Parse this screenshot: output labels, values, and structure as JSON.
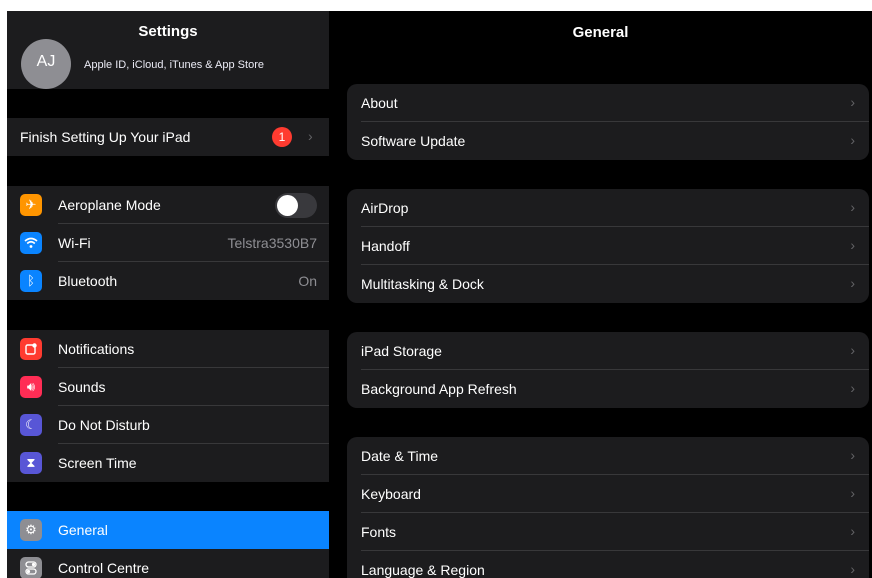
{
  "sidebar": {
    "title": "Settings",
    "profile": {
      "initials": "AJ",
      "subtitle": "Apple ID, iCloud, iTunes & App Store"
    },
    "finish_setup": {
      "label": "Finish Setting Up Your iPad",
      "badge": "1"
    },
    "connectivity": [
      {
        "label": "Aeroplane Mode",
        "icon": "airplane-icon",
        "color": "#ff9500",
        "toggle": false
      },
      {
        "label": "Wi-Fi",
        "icon": "wifi-icon",
        "color": "#0a84ff",
        "value": "Telstra3530B7"
      },
      {
        "label": "Bluetooth",
        "icon": "bluetooth-icon",
        "color": "#0a84ff",
        "value": "On"
      }
    ],
    "alerts": [
      {
        "label": "Notifications",
        "icon": "notifications-icon",
        "color": "#ff3b30"
      },
      {
        "label": "Sounds",
        "icon": "sounds-icon",
        "color": "#ff2d55"
      },
      {
        "label": "Do Not Disturb",
        "icon": "moon-icon",
        "color": "#5856d6"
      },
      {
        "label": "Screen Time",
        "icon": "hourglass-icon",
        "color": "#5856d6"
      }
    ],
    "system": [
      {
        "label": "General",
        "icon": "gear-icon",
        "color": "#8e8e93",
        "selected": true
      },
      {
        "label": "Control Centre",
        "icon": "control-centre-icon",
        "color": "#8e8e93"
      }
    ]
  },
  "main": {
    "title": "General",
    "groups": [
      [
        "About",
        "Software Update"
      ],
      [
        "AirDrop",
        "Handoff",
        "Multitasking & Dock"
      ],
      [
        "iPad Storage",
        "Background App Refresh"
      ],
      [
        "Date & Time",
        "Keyboard",
        "Fonts",
        "Language & Region"
      ]
    ]
  }
}
